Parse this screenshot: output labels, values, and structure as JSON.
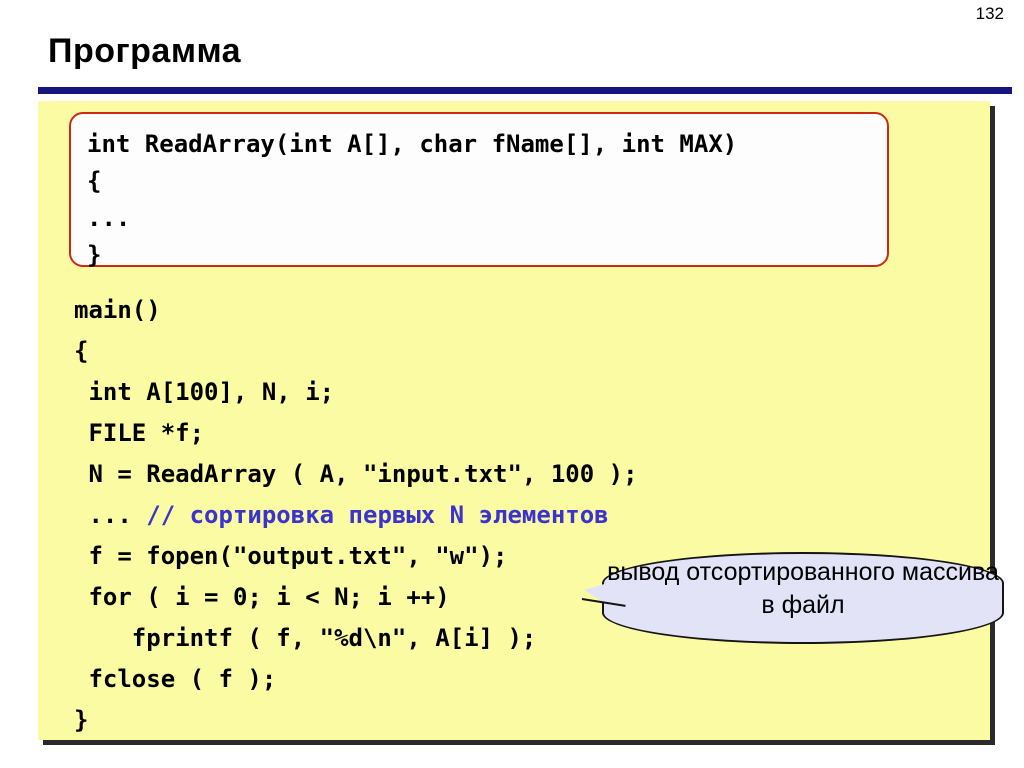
{
  "slide": {
    "page_number": "132",
    "title": "Программа",
    "rule_color": "#16167e",
    "panel_color": "#fbfba4"
  },
  "function_box": {
    "border_color": "#cc2b12",
    "background": "#fdfdfd",
    "lines": [
      "int ReadArray(int A[], char fName[], int MAX)",
      "{",
      "...",
      "}"
    ]
  },
  "main_code": {
    "comment_color": "#3a34cc",
    "lines": [
      {
        "text": "main()",
        "comment": ""
      },
      {
        "text": "{",
        "comment": ""
      },
      {
        "text": " int A[100], N, i;",
        "comment": ""
      },
      {
        "text": " FILE *f;",
        "comment": ""
      },
      {
        "text": " N = ReadArray ( A, \"input.txt\", 100 );",
        "comment": ""
      },
      {
        "text": " ... ",
        "comment": "// сортировка первых N элементов"
      },
      {
        "text": " f = fopen(\"output.txt\", \"w\");",
        "comment": ""
      },
      {
        "text": " for ( i = 0; i < N; i ++)",
        "comment": ""
      },
      {
        "text": "    fprintf ( f, \"%d\\n\", A[i] );",
        "comment": ""
      },
      {
        "text": " fclose ( f );",
        "comment": ""
      },
      {
        "text": "}",
        "comment": ""
      }
    ]
  },
  "callout": {
    "text": "вывод отсортированного массива в файл",
    "fill_color": "#e3e3f8",
    "border_color": "#151515"
  }
}
